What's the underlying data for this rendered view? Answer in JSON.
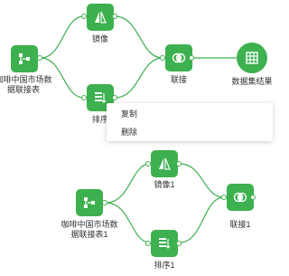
{
  "flow1": {
    "source_label": "咖啡中国市场数据联接表",
    "mirror_label": "镜像",
    "sort_label": "排序",
    "join_label": "联接",
    "result_label": "数据集结果"
  },
  "flow2": {
    "source_label": "咖啡中国市场数据联接表1",
    "mirror_label": "镜像1",
    "sort_label": "排序1",
    "join_label": "联接1"
  },
  "context_menu": {
    "items": [
      "复制",
      "删除"
    ]
  },
  "colors": {
    "node_green": "#3db04f",
    "edge_green": "#3db04f",
    "background": "#ffffff"
  },
  "icons": {
    "source": "flow-split-icon",
    "mirror": "mirror-triangle-icon",
    "sort": "sort-list-icon",
    "join": "join-circles-icon",
    "result": "table-grid-icon"
  }
}
